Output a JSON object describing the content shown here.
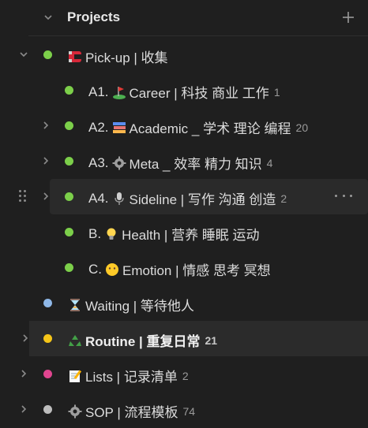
{
  "header": {
    "title": "Projects"
  },
  "items": [
    {
      "prefix": "",
      "name": "Pick-up | 收集",
      "count": "",
      "color": "#7ccf4a",
      "icon": "magnet-icon"
    },
    {
      "prefix": "A1.",
      "name": "Career | 科技 商业 工作",
      "count": "1",
      "color": "#7ccf4a",
      "icon": "golf-icon"
    },
    {
      "prefix": "A2.",
      "name": "Academic _ 学术 理论 编程",
      "count": "20",
      "color": "#7ccf4a",
      "icon": "books-icon"
    },
    {
      "prefix": "A3.",
      "name": "Meta _ 效率 精力 知识",
      "count": "4",
      "color": "#7ccf4a",
      "icon": "gear-icon"
    },
    {
      "prefix": "A4.",
      "name": "Sideline | 写作 沟通 创造",
      "count": "2",
      "color": "#7ccf4a",
      "icon": "microphone-icon"
    },
    {
      "prefix": "B.",
      "name": "Health | 营养 睡眠 运动",
      "count": "",
      "color": "#7ccf4a",
      "icon": "lightbulb-icon"
    },
    {
      "prefix": "C.",
      "name": "Emotion | 情感 思考 冥想",
      "count": "",
      "color": "#7ccf4a",
      "icon": "face-icon"
    },
    {
      "prefix": "",
      "name": "Waiting | 等待他人",
      "count": "",
      "color": "#8fb8e8",
      "icon": "hourglass-icon"
    },
    {
      "prefix": "",
      "name": "Routine | 重复日常",
      "count": "21",
      "color": "#f5c518",
      "icon": "recycle-icon"
    },
    {
      "prefix": "",
      "name": "Lists | 记录清单",
      "count": "2",
      "color": "#e0458f",
      "icon": "memo-icon"
    },
    {
      "prefix": "",
      "name": "SOP | 流程模板",
      "count": "74",
      "color": "#bdbdbd",
      "icon": "gear-icon"
    }
  ]
}
